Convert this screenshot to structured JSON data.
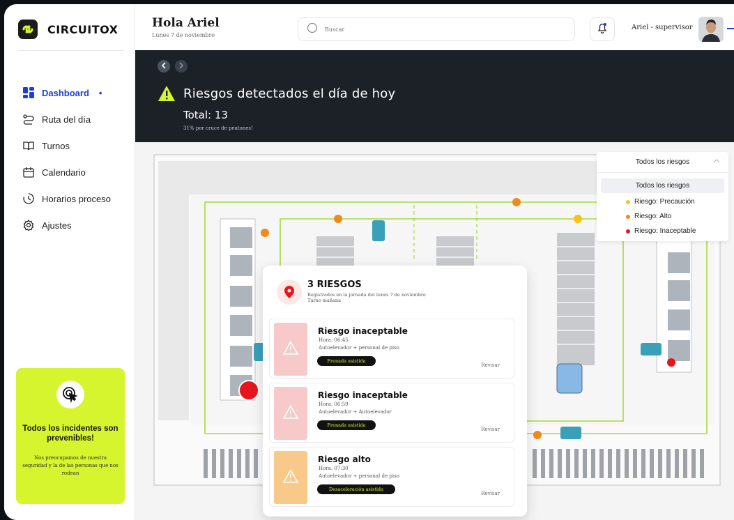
{
  "brand": {
    "name": "CIRCUITOX"
  },
  "sidebar": {
    "items": [
      {
        "label": "Dashboard",
        "icon": "grid-icon",
        "active": true,
        "marker": "•"
      },
      {
        "label": "Ruta del día",
        "icon": "route-icon"
      },
      {
        "label": "Turnos",
        "icon": "book-icon"
      },
      {
        "label": "Calendario",
        "icon": "calendar-icon"
      },
      {
        "label": "Horarios proceso",
        "icon": "clock-icon"
      },
      {
        "label": "Ajustes",
        "icon": "gear-icon"
      }
    ],
    "promo": {
      "title": "Todos los incidentes son prevenibles!",
      "body": "Nos preocupamos de nuestra seguridad y la de las personas que nos rodean",
      "icon": "target-cursor-icon"
    }
  },
  "header": {
    "greeting": "Hola Ariel",
    "date": "Lunes 7 de noviembre",
    "search_placeholder": "Buscar",
    "user": "Ariel - supervisor"
  },
  "banner": {
    "title": "Riesgos detectados el día de hoy",
    "total": "Total: 13",
    "subtitle": "31% por cruce de peatones!"
  },
  "filter": {
    "current": "Todos los riesgos",
    "options": [
      {
        "label": "Todos los riesgos",
        "color": ""
      },
      {
        "label": "Riesgo: Precaución",
        "color": "#f5c518"
      },
      {
        "label": "Riesgo: Alto",
        "color": "#f08a1c"
      },
      {
        "label": "Riesgo: Inaceptable",
        "color": "#e8141b"
      }
    ]
  },
  "popup": {
    "title": "3 RIESGOS",
    "sub1": "Registrados en la jornada del lunes 7 de noviembre",
    "sub2": "Turno mañana",
    "cards": [
      {
        "title": "Riesgo inaceptable",
        "time": "Hora: 06:45",
        "desc": "Autoelevador  + personal de piso",
        "pill": "Frenada asistida",
        "action": "Revisar",
        "color": "#f8c9c9"
      },
      {
        "title": "Riesgo inaceptable",
        "time": "Hora: 06:59",
        "desc": "Autoelevador + Autoelevador",
        "pill": "Frenada asistida",
        "action": "Revisar",
        "color": "#f8c9c9"
      },
      {
        "title": "Riesgo alto",
        "time": "Hora: 07:30",
        "desc": "Autoelevador + personal de piso",
        "pill": "Desaceleración asistida",
        "action": "Revisar",
        "color": "#f9c98a"
      }
    ]
  },
  "colors": {
    "accent": "#1b3fd6",
    "lime": "#d7f52e",
    "banner": "#1c2128",
    "route": "#9ed33a",
    "forklift": "#3aa0b8"
  }
}
